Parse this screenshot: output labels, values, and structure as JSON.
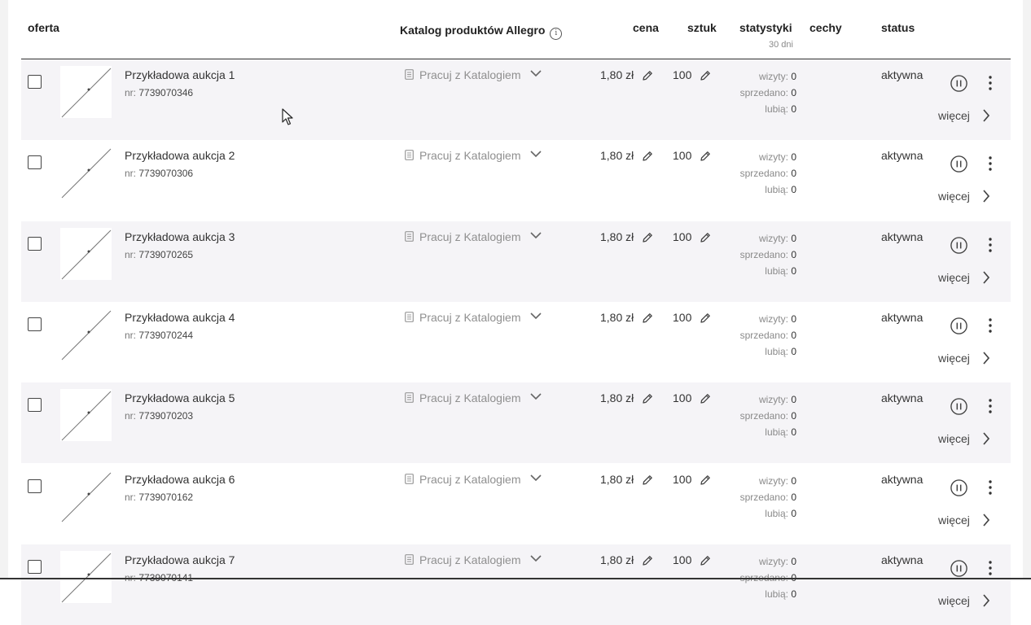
{
  "header": {
    "col_offer": "oferta",
    "col_catalog": "Katalog produktów Allegro",
    "col_price": "cena",
    "col_qty": "sztuk",
    "col_stats": "statystyki",
    "col_stats_sub": "30 dni",
    "col_features": "cechy",
    "col_status": "status"
  },
  "labels": {
    "nr_prefix": "nr:",
    "catalog_action": "Pracuj z Katalogiem",
    "stat_visits": "wizyty:",
    "stat_sold": "sprzedano:",
    "stat_likes": "lubią:",
    "more": "więcej"
  },
  "colors": {
    "shaded_row": "#f5f4f7",
    "catalog_text": "#8f8f8f"
  },
  "icons": [
    "info-icon",
    "document-icon",
    "chevron-down-icon",
    "pencil-icon",
    "pause-icon",
    "kebab-menu-icon",
    "chevron-right-icon",
    "cursor-icon"
  ],
  "offers": [
    {
      "title": "Przykładowa aukcja 1",
      "nr": "7739070346",
      "price": "1,80 zł",
      "qty": "100",
      "visits": "0",
      "sold": "0",
      "likes": "0",
      "status": "aktywna"
    },
    {
      "title": "Przykładowa aukcja 2",
      "nr": "7739070306",
      "price": "1,80 zł",
      "qty": "100",
      "visits": "0",
      "sold": "0",
      "likes": "0",
      "status": "aktywna"
    },
    {
      "title": "Przykładowa aukcja 3",
      "nr": "7739070265",
      "price": "1,80 zł",
      "qty": "100",
      "visits": "0",
      "sold": "0",
      "likes": "0",
      "status": "aktywna"
    },
    {
      "title": "Przykładowa aukcja 4",
      "nr": "7739070244",
      "price": "1,80 zł",
      "qty": "100",
      "visits": "0",
      "sold": "0",
      "likes": "0",
      "status": "aktywna"
    },
    {
      "title": "Przykładowa aukcja 5",
      "nr": "7739070203",
      "price": "1,80 zł",
      "qty": "100",
      "visits": "0",
      "sold": "0",
      "likes": "0",
      "status": "aktywna"
    },
    {
      "title": "Przykładowa aukcja 6",
      "nr": "7739070162",
      "price": "1,80 zł",
      "qty": "100",
      "visits": "0",
      "sold": "0",
      "likes": "0",
      "status": "aktywna"
    },
    {
      "title": "Przykładowa aukcja 7",
      "nr": "7739070141",
      "price": "1,80 zł",
      "qty": "100",
      "visits": "0",
      "sold": "0",
      "likes": "0",
      "status": "aktywna"
    }
  ]
}
